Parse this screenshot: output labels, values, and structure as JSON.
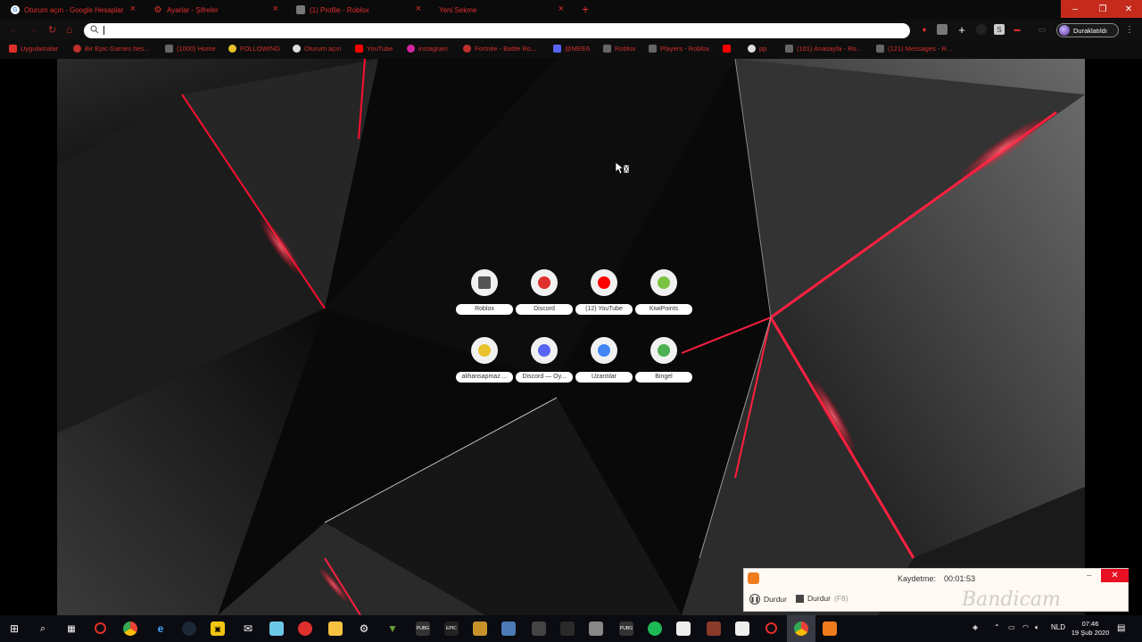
{
  "tabs": [
    {
      "title": "Oturum açın - Google Hesapları",
      "icon": "google-icon",
      "color": "#4285f4"
    },
    {
      "title": "Ayarlar - Şifreler",
      "icon": "gear-icon",
      "color": "#e0302c"
    },
    {
      "title": "(1) Profile - Roblox",
      "icon": "roblox-icon",
      "color": "#888888"
    },
    {
      "title": "Yeni Sekme",
      "icon": "",
      "color": ""
    }
  ],
  "window_controls": {
    "minimize": "–",
    "restore": "❐",
    "close": "✕"
  },
  "toolbar": {
    "search_placeholder": "",
    "search_value": "",
    "profile_status": "Duraklatıldı"
  },
  "bookmarks": [
    {
      "label": "Uygulamalar",
      "icon": "apps-grid-icon",
      "color": "#e0302c"
    },
    {
      "label": "Bir Epic Games hes...",
      "icon": "epic-icon",
      "color": "#c0302c"
    },
    {
      "label": "(1000) Home",
      "icon": "roblox-icon",
      "color": "#666666"
    },
    {
      "label": "FOLLOWING",
      "icon": "smiley-icon",
      "color": "#e8c22a"
    },
    {
      "label": "Oturum açın",
      "icon": "google-icon",
      "color": "#dddddd"
    },
    {
      "label": "YouTube",
      "icon": "youtube-icon",
      "color": "#ff0000"
    },
    {
      "label": "instagram",
      "icon": "instagram-icon",
      "color": "#d6249f"
    },
    {
      "label": "Fortnite - Battle Ro...",
      "icon": "epic-icon",
      "color": "#c0302c"
    },
    {
      "label": "@MEE6",
      "icon": "discord-icon",
      "color": "#5865f2"
    },
    {
      "label": "Roblox",
      "icon": "roblox-icon",
      "color": "#666666"
    },
    {
      "label": "Players - Roblox",
      "icon": "roblox-icon",
      "color": "#666666"
    },
    {
      "label": "",
      "icon": "youtube-icon",
      "color": "#ff0000"
    },
    {
      "label": "pp",
      "icon": "google-icon",
      "color": "#dddddd"
    },
    {
      "label": "(101) Anasayfa - Ro...",
      "icon": "roblox-icon",
      "color": "#666666"
    },
    {
      "label": "(121) Messages - R...",
      "icon": "roblox-icon",
      "color": "#666666"
    }
  ],
  "shortcuts": [
    {
      "label": "Roblox",
      "icon": "roblox-icon",
      "color": "#555555"
    },
    {
      "label": "Discord",
      "icon": "discord-icon",
      "color": "#e0302c"
    },
    {
      "label": "(12) YouTube",
      "icon": "youtube-icon",
      "color": "#ff0000"
    },
    {
      "label": "KiwiPoints",
      "icon": "kiwi-icon",
      "color": "#7cc242"
    },
    {
      "label": "alihansapmaz ...",
      "icon": "smiley-icon",
      "color": "#e8c22a"
    },
    {
      "label": "Discord — Oy...",
      "icon": "discord-icon",
      "color": "#5865f2"
    },
    {
      "label": "Uzantılar",
      "icon": "extensions-icon",
      "color": "#4285f4"
    },
    {
      "label": "Bingel",
      "icon": "bingel-icon",
      "color": "#4caf50"
    }
  ],
  "recorder": {
    "title": "Kaydetme:",
    "elapsed": "00:01:53",
    "pause_label": "Durdur",
    "stop_label": "Durdur",
    "stop_key": "(F8)",
    "minimize": "–",
    "close": "✕",
    "watermark": "Bandicam"
  },
  "taskbar": {
    "language": "NLD",
    "time": "07:46",
    "date": "19 Şub 2020"
  },
  "colors": {
    "accent_red": "#e0302c",
    "tab_bg": "#0b0b0b",
    "taskbar_bg": "#0b0b12"
  }
}
